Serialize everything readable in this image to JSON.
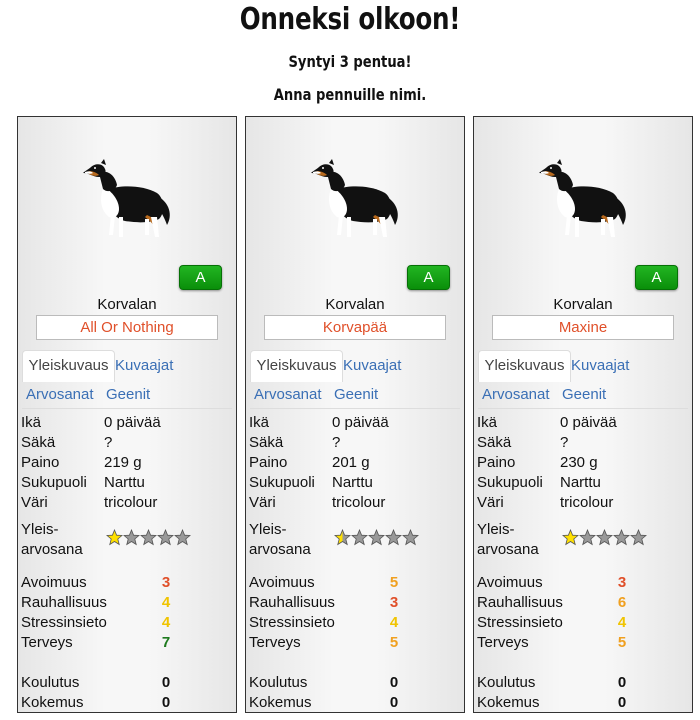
{
  "header": {
    "title": "Onneksi olkoon!",
    "subtitle1": "Syntyi 3 pentua!",
    "subtitle2": "Anna pennuille nimi."
  },
  "labels": {
    "age": "Ikä",
    "height": "Säkä",
    "weight": "Paino",
    "sex": "Sukupuoli",
    "color": "Väri",
    "overall1": "Yleis-",
    "overall2": "arvosana",
    "openness": "Avoimuus",
    "calmness": "Rauhallisuus",
    "stress": "Stressinsieto",
    "health": "Terveys",
    "training": "Koulutus",
    "experience": "Kokemus"
  },
  "tabs": {
    "overview": "Yleiskuvaus",
    "photographers": "Kuvaajat",
    "ratings": "Arvosanat",
    "genes": "Geenit"
  },
  "colors": {
    "name": "#e0502a",
    "tab_link": "#3a6fb5",
    "button": "#11a011",
    "trait_3": "#e0502a",
    "trait_4": "#f0c400",
    "trait_5": "#f0a020",
    "trait_6": "#f0a020",
    "trait_7": "#1e7a1e"
  },
  "puppies": [
    {
      "button": "A",
      "breed": "Korvalan",
      "name": "All Or Nothing",
      "age": "0 päivää",
      "height": "?",
      "weight": "219 g",
      "sex": "Narttu",
      "color": "tricolour",
      "rating_stars": 1,
      "openness": "3",
      "calmness": "4",
      "stress": "4",
      "health": "7",
      "training": "0",
      "experience": "0"
    },
    {
      "button": "A",
      "breed": "Korvalan",
      "name": "Korvapää",
      "age": "0 päivää",
      "height": "?",
      "weight": "201 g",
      "sex": "Narttu",
      "color": "tricolour",
      "rating_stars": 0.5,
      "openness": "5",
      "calmness": "3",
      "stress": "4",
      "health": "5",
      "training": "0",
      "experience": "0"
    },
    {
      "button": "A",
      "breed": "Korvalan",
      "name": "Maxine",
      "age": "0 päivää",
      "height": "?",
      "weight": "230 g",
      "sex": "Narttu",
      "color": "tricolour",
      "rating_stars": 1,
      "openness": "3",
      "calmness": "6",
      "stress": "4",
      "health": "5",
      "training": "0",
      "experience": "0"
    }
  ]
}
